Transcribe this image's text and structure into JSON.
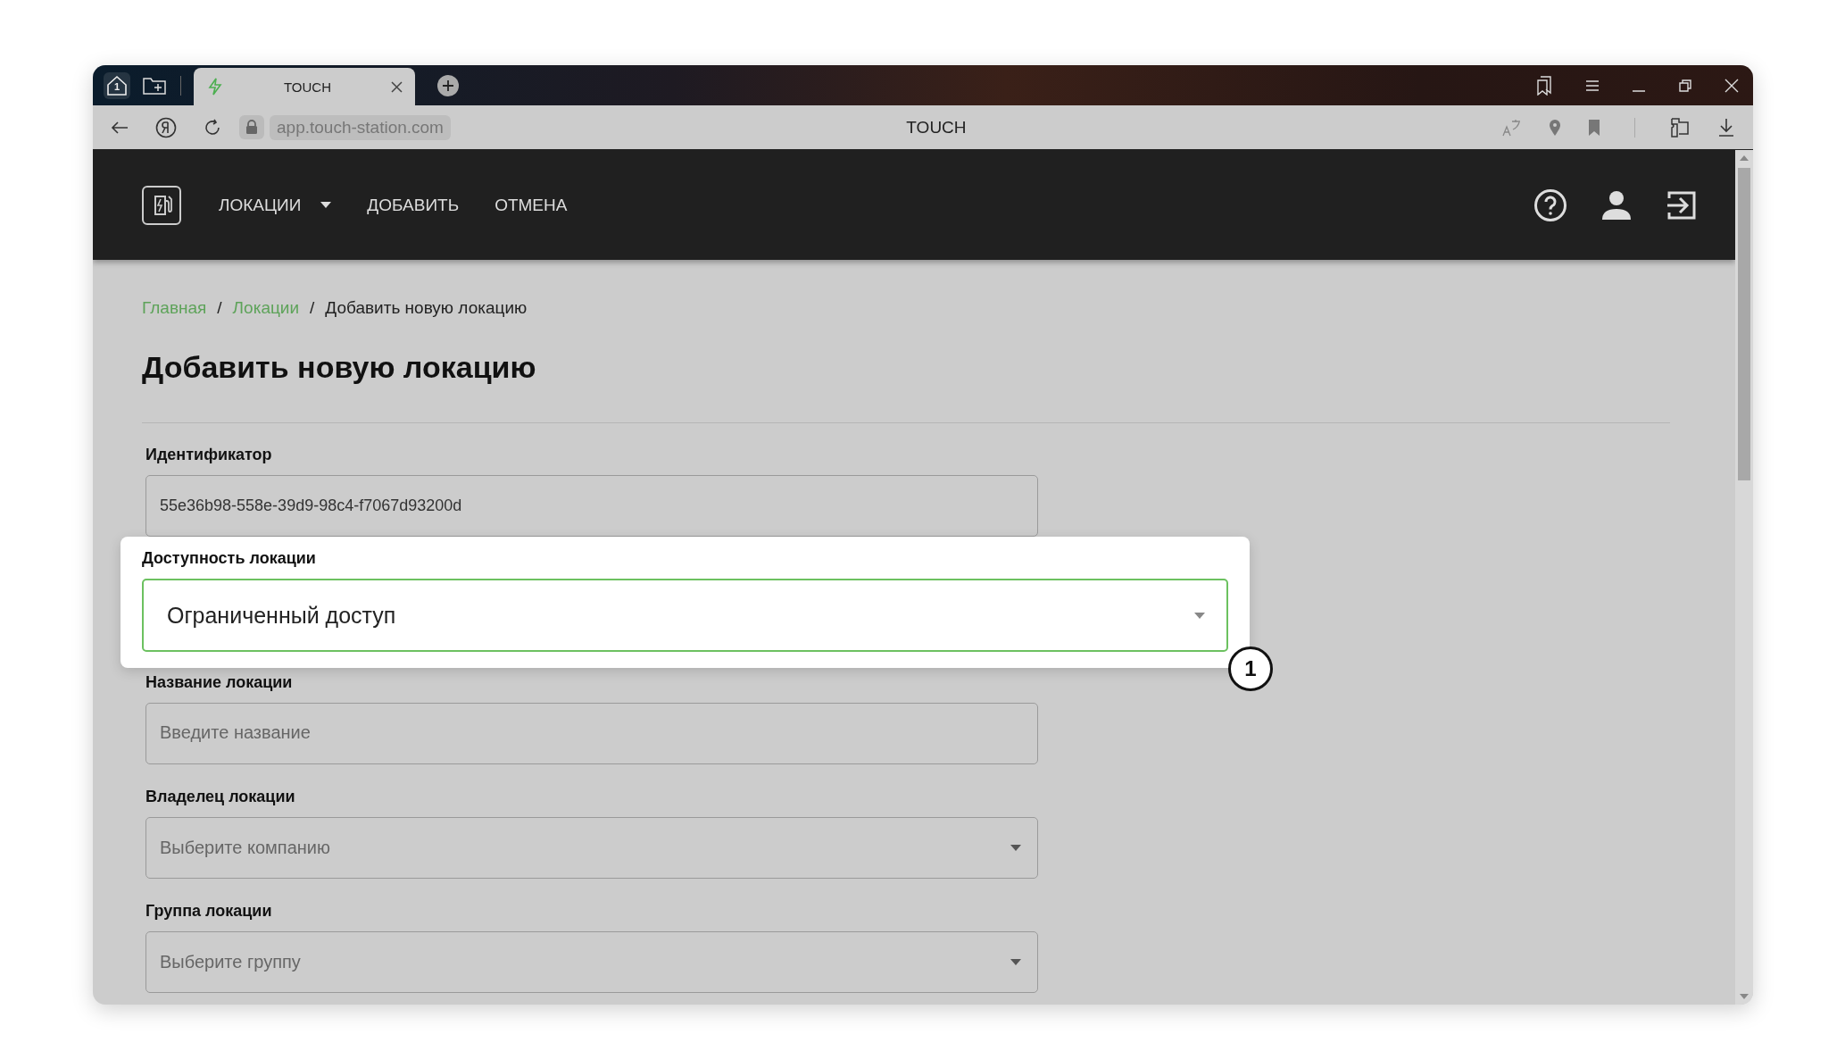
{
  "browser": {
    "home_badge": "1",
    "tabs": [
      {
        "title": "TOUCH",
        "selected": true
      }
    ],
    "url": "app.touch-station.com",
    "page_title": "TOUCH"
  },
  "nav": {
    "items": [
      {
        "label": "ЛОКАЦИИ",
        "kind": "dropdown"
      },
      {
        "label": "ДОБАВИТЬ",
        "kind": "link"
      },
      {
        "label": "ОТМЕНА",
        "kind": "link"
      }
    ]
  },
  "breadcrumbs": [
    {
      "label": "Главная",
      "kind": "link"
    },
    {
      "separator": "/",
      "label": "Локации",
      "kind": "link"
    },
    {
      "separator": "/",
      "label": "Добавить новую локацию",
      "kind": "current"
    }
  ],
  "title": "Добавить новую локацию",
  "fields": [
    {
      "label": "Идентификатор",
      "kind": "input",
      "value": "55e36b98-558e-39d9-98c4-f7067d93200d",
      "highlighted": false
    },
    {
      "label": "Доступность локации",
      "kind": "select",
      "value": "Ограниченный доступ",
      "highlighted": true,
      "callout": "1"
    },
    {
      "label": "Название локации",
      "kind": "input",
      "placeholder": "Введите название",
      "highlighted": false
    },
    {
      "label": "Владелец локации",
      "kind": "select",
      "placeholder": "Выберите компанию",
      "highlighted": false
    },
    {
      "label": "Группа локации",
      "kind": "select",
      "placeholder": "Выберите группу",
      "highlighted": false
    }
  ]
}
